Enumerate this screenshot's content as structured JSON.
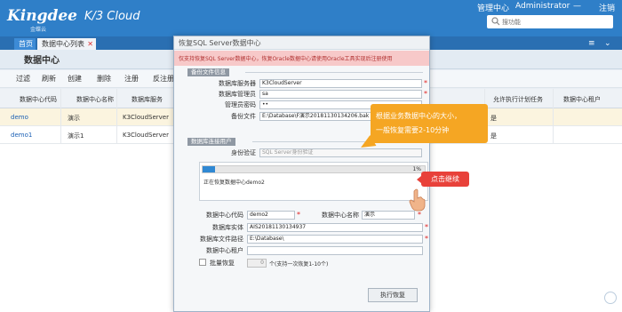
{
  "app": {
    "logo_text": "Kingdee",
    "logo_sub": "金蝶云",
    "product": "K/3 Cloud",
    "menu_admin": "管理中心",
    "user": "Administrator",
    "org": "—",
    "logout": "注销",
    "search_placeholder": "搜功能"
  },
  "tabs": {
    "home": "首页",
    "active": "数据中心列表"
  },
  "page": {
    "title": "数据中心"
  },
  "toolbar": [
    "过滤",
    "刷新",
    "创建",
    "删除",
    "注册",
    "反注册"
  ],
  "grid": {
    "headers": [
      "数据中心代码",
      "数据中心名称",
      "数据库服务",
      "允许执行计划任务",
      "数据中心租户"
    ],
    "rows": [
      {
        "code": "demo",
        "name": "演示",
        "server": "K3CloudServer",
        "allow": "是"
      },
      {
        "code": "demo1",
        "name": "演示1",
        "server": "K3CloudServer",
        "allow": "是"
      }
    ]
  },
  "dialog": {
    "title": "恢复SQL Server数据中心",
    "warning": "仅支持恢复SQL Server数据中心，恢复Oracle数据中心请使用Oracle工具实现后注册使用",
    "section_backup": "备份文件信息",
    "section_auth": "数据库连接用户",
    "backup": {
      "server_label": "数据库服务器",
      "server_value": "K3CloudServer",
      "admin_label": "数据库管理员",
      "admin_value": "sa",
      "pwd_label": "管理员密码",
      "pwd_value": "••",
      "file_label": "备份文件",
      "file_value": "E:\\Database\\F演示20181130134206.bak"
    },
    "auth_label": "身份验证",
    "auth_value": "SQL Server身份验证",
    "progress": {
      "percent": 0.01,
      "percent_text": "1%",
      "message": "正在恢复数据中心demo2"
    },
    "dc_code_label": "数据中心代码",
    "dc_code_value": "demo2",
    "dc_name_label": "数据中心名称",
    "dc_name_value": "演示",
    "db_entity_label": "数据库实体",
    "db_entity_value": "AIS20181130134937",
    "db_path_label": "数据库文件路径",
    "db_path_value": "E:\\Database\\",
    "tenant_label": "数据中心租户",
    "batch_label": "批量恢复",
    "batch_value": "0",
    "batch_hint": "个(支持一次恢复1-10个)",
    "exec_button": "执行恢复"
  },
  "callouts": {
    "tip_line1": "根据业务数据中心的大小，",
    "tip_line2": "一般恢复需要2-10分钟",
    "click_continue": "点击继续"
  },
  "colors": {
    "topbar": "#2f7fc8",
    "progress": "#2f88d3",
    "tip": "#f5a623",
    "click": "#e8413a"
  }
}
